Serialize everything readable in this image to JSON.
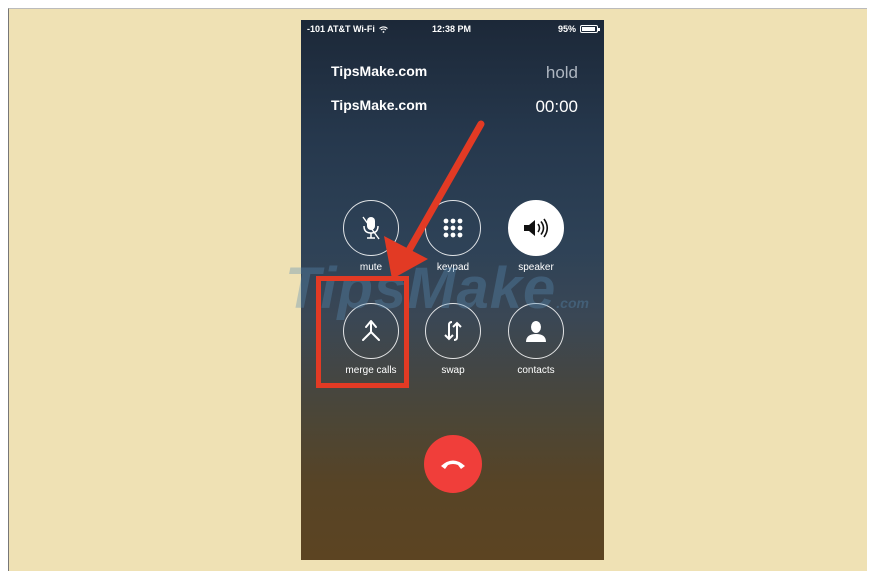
{
  "status_bar": {
    "carrier": "-101 AT&T Wi-Fi",
    "time": "12:38 PM",
    "battery": "95%"
  },
  "calls": [
    {
      "name": "TipsMake.com",
      "state": "hold"
    },
    {
      "name": "TipsMake.com",
      "state": "00:00"
    }
  ],
  "controls": {
    "mute": "mute",
    "keypad": "keypad",
    "speaker": "speaker",
    "merge_calls": "merge calls",
    "swap": "swap",
    "contacts": "contacts"
  },
  "watermark": {
    "main": "TipsMake",
    "suffix": ".com"
  },
  "colors": {
    "annotation": "#e23a24",
    "end_call": "#f03e3a",
    "page_bg": "#efe1b4"
  },
  "icons": [
    "wifi-icon",
    "battery-icon",
    "mute-icon",
    "keypad-icon",
    "speaker-icon",
    "merge-calls-icon",
    "swap-icon",
    "contacts-icon",
    "end-call-icon",
    "arrow-icon"
  ]
}
